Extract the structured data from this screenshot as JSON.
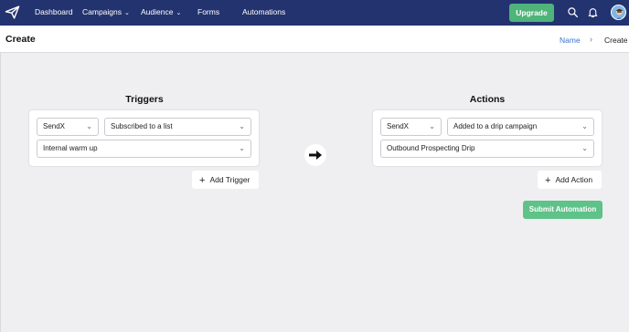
{
  "nav": {
    "items": [
      {
        "label": "Dashboard",
        "has_dropdown": false
      },
      {
        "label": "Campaigns",
        "has_dropdown": true
      },
      {
        "label": "Audience",
        "has_dropdown": true
      },
      {
        "label": "Forms",
        "has_dropdown": false
      },
      {
        "label": "Automations",
        "has_dropdown": false
      }
    ],
    "upgrade_label": "Upgrade",
    "icons": [
      "paper-plane-logo-icon",
      "search-icon",
      "bell-icon",
      "avatar"
    ]
  },
  "header": {
    "title": "Create",
    "breadcrumb_link": "Name",
    "breadcrumb_separator": "›",
    "breadcrumb_current": "Create"
  },
  "triggers": {
    "title": "Triggers",
    "app_select": "SendX",
    "event_select": "Subscribed to a list",
    "list_select": "Internal warm up",
    "add_label": "Add Trigger"
  },
  "actions": {
    "title": "Actions",
    "app_select": "SendX",
    "event_select": "Added to a drip campaign",
    "campaign_select": "Outbound Prospecting Drip",
    "add_label": "Add Action"
  },
  "submit_label": "Submit Automation",
  "colors": {
    "nav_bg": "#23336f",
    "accent_green": "#4fb47a",
    "link_blue": "#3c74c9",
    "page_bg": "#efeff1"
  }
}
